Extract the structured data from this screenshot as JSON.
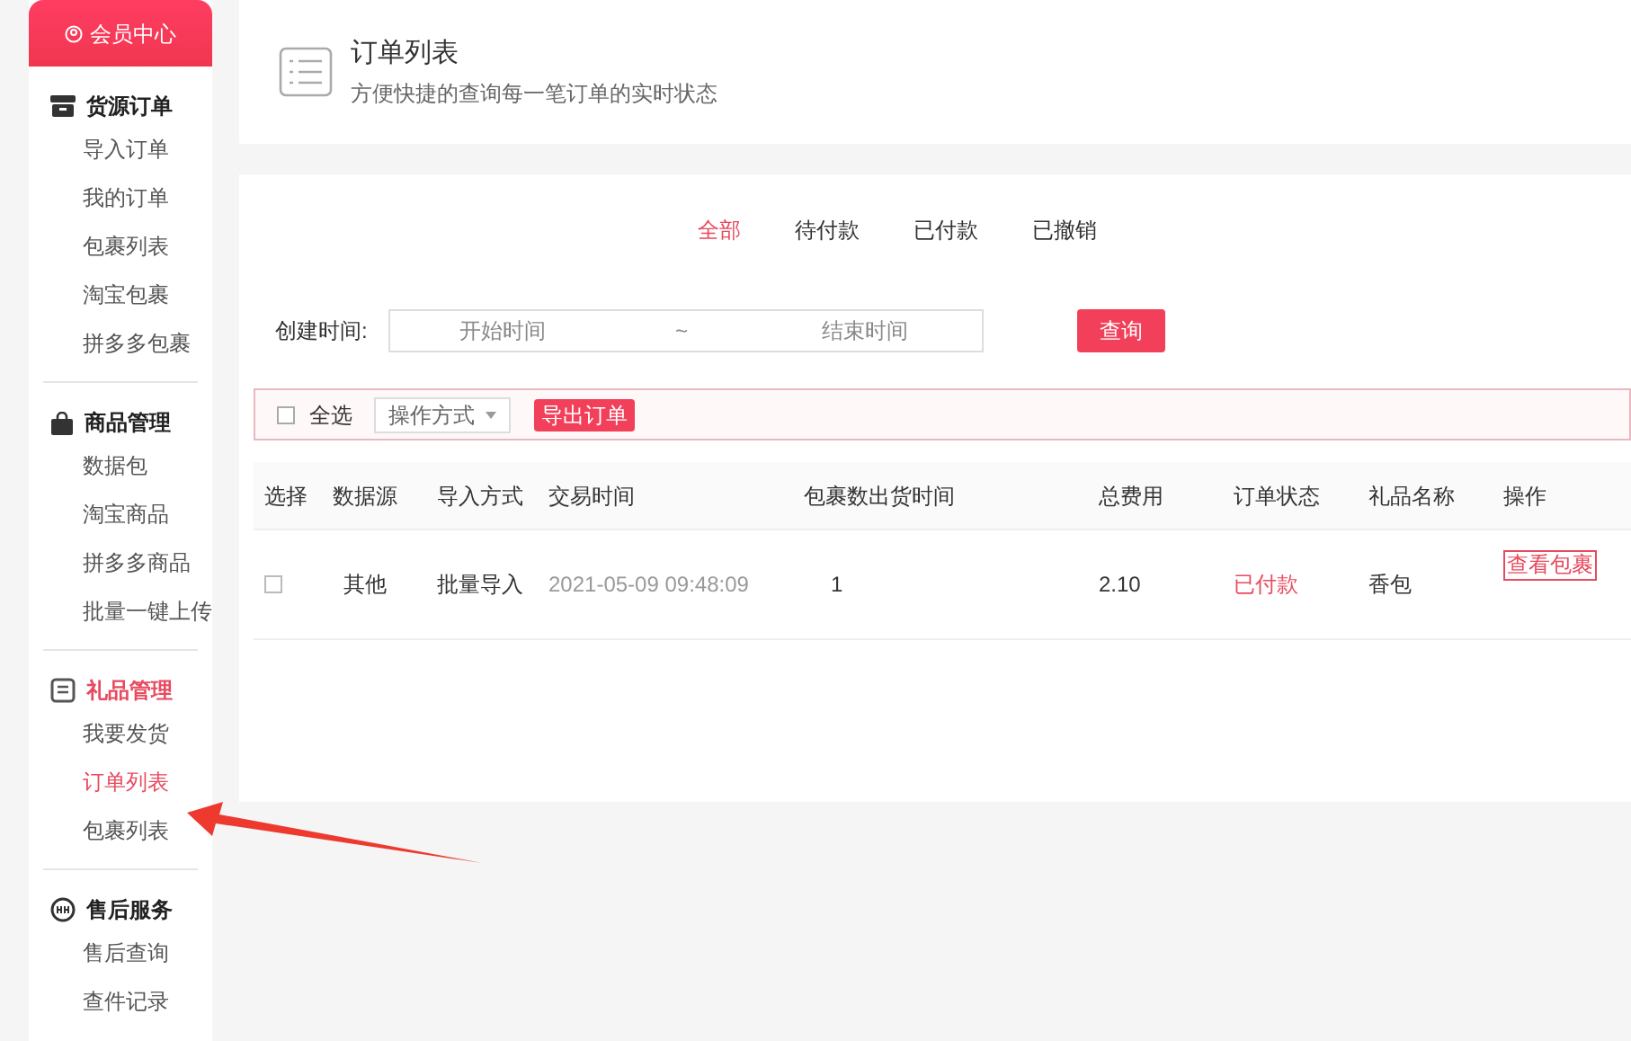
{
  "sidebar": {
    "banner": "会员中心",
    "groups": [
      {
        "title": "货源订单",
        "kind": "box",
        "selected": false,
        "items": [
          {
            "label": "导入订单",
            "selected": false
          },
          {
            "label": "我的订单",
            "selected": false
          },
          {
            "label": "包裹列表",
            "selected": false
          },
          {
            "label": "淘宝包裹",
            "selected": false
          },
          {
            "label": "拼多多包裹",
            "selected": false
          }
        ]
      },
      {
        "title": "商品管理",
        "kind": "bag",
        "selected": false,
        "items": [
          {
            "label": "数据包",
            "selected": false
          },
          {
            "label": "淘宝商品",
            "selected": false
          },
          {
            "label": "拼多多商品",
            "selected": false
          },
          {
            "label": "批量一键上传",
            "selected": false
          }
        ]
      },
      {
        "title": "礼品管理",
        "kind": "gift",
        "selected": true,
        "items": [
          {
            "label": "我要发货",
            "selected": false
          },
          {
            "label": "订单列表",
            "selected": true
          },
          {
            "label": "包裹列表",
            "selected": false
          }
        ]
      },
      {
        "title": "售后服务",
        "kind": "service",
        "selected": false,
        "items": [
          {
            "label": "售后查询",
            "selected": false
          },
          {
            "label": "查件记录",
            "selected": false
          }
        ]
      }
    ]
  },
  "header": {
    "title": "订单列表",
    "subtitle": "方便快捷的查询每一笔订单的实时状态"
  },
  "tabs": [
    {
      "label": "全部",
      "selected": true
    },
    {
      "label": "待付款",
      "selected": false
    },
    {
      "label": "已付款",
      "selected": false
    },
    {
      "label": "已撤销",
      "selected": false
    }
  ],
  "filter": {
    "label": "创建时间:",
    "start_placeholder": "开始时间",
    "separator": "~",
    "end_placeholder": "结束时间",
    "button": "查询"
  },
  "toolbar": {
    "select_all": {
      "label": "全选",
      "checked": false
    },
    "action_select": "操作方式",
    "export_button": "导出订单"
  },
  "table": {
    "columns": [
      "选择",
      "数据源",
      "导入方式",
      "交易时间",
      "包裹数出货时间",
      "总费用",
      "订单状态",
      "礼品名称",
      "操作"
    ],
    "rows": [
      {
        "checked": false,
        "source": "其他",
        "import_method": "批量导入",
        "time": "2021-05-09 09:48:09",
        "packages": "1",
        "total": "2.10",
        "status": "已付款",
        "gift": "香包",
        "action": "查看包裹"
      }
    ]
  }
}
